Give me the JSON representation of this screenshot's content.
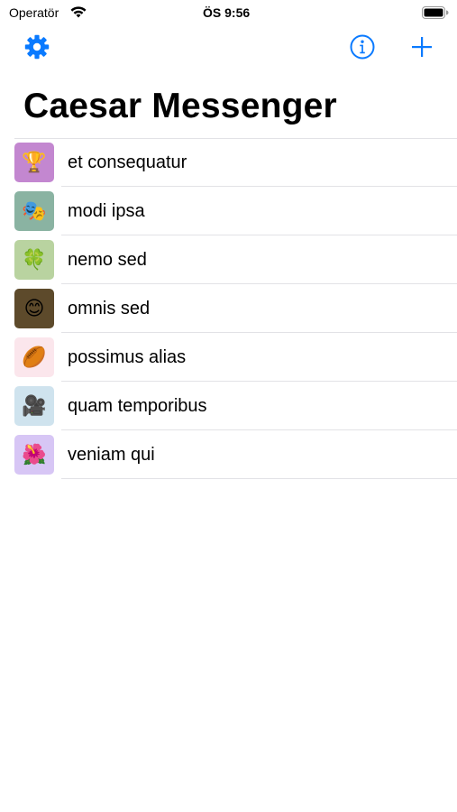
{
  "status_bar": {
    "carrier": "Operatör",
    "time": "ÖS 9:56"
  },
  "nav_bar": {
    "left_icon": "gear-icon",
    "right_icons": [
      "info-icon",
      "plus-icon"
    ],
    "accent_color": "#0a7aff"
  },
  "title": "Caesar Messenger",
  "chats": [
    {
      "label": "et consequatur",
      "emoji": "🏆",
      "color": "#c387d0"
    },
    {
      "label": "modi ipsa",
      "emoji": "🎭",
      "color": "#8ab3a2"
    },
    {
      "label": "nemo sed",
      "emoji": "🍀",
      "color": "#b9d3a0"
    },
    {
      "label": "omnis sed",
      "emoji": "😊",
      "color": "#5d4a2b"
    },
    {
      "label": "possimus alias",
      "emoji": "🏉",
      "color": "#fbe6ec"
    },
    {
      "label": "quam temporibus",
      "emoji": "🎥",
      "color": "#cfe3ee"
    },
    {
      "label": "veniam qui",
      "emoji": "🌺",
      "color": "#d7c6f5"
    }
  ]
}
